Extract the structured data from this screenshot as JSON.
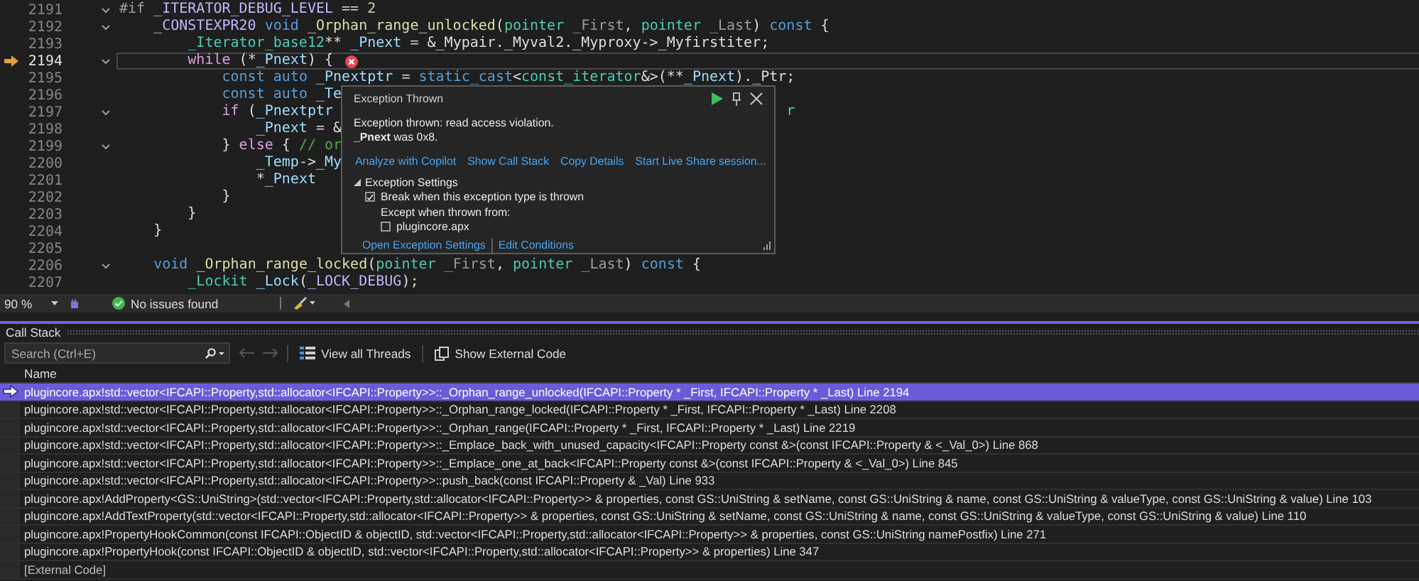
{
  "editor": {
    "lines": [
      {
        "number": "2191",
        "current": false,
        "foldable": true,
        "segments": [
          {
            "text": "#if",
            "kind": "preproc"
          },
          {
            "text": " _ITERATOR_DEBUG_LEVEL",
            "kind": "macro"
          },
          {
            "text": " ==",
            "kind": "plain"
          },
          {
            "text": " 2",
            "kind": "number"
          }
        ]
      },
      {
        "number": "2192",
        "current": false,
        "foldable": true,
        "segments": [
          {
            "text": "    _CONSTEXPR20",
            "kind": "macro"
          },
          {
            "text": " void",
            "kind": "keyword"
          },
          {
            "text": " _Orphan_range_unlocked",
            "kind": "func"
          },
          {
            "text": "(",
            "kind": "plain"
          },
          {
            "text": "pointer",
            "kind": "type"
          },
          {
            "text": " _First",
            "kind": "param"
          },
          {
            "text": ",",
            "kind": "plain"
          },
          {
            "text": " pointer",
            "kind": "type"
          },
          {
            "text": " _Last",
            "kind": "param"
          },
          {
            "text": ")",
            "kind": "plain"
          },
          {
            "text": " const",
            "kind": "keyword"
          },
          {
            "text": " {",
            "kind": "plain"
          }
        ]
      },
      {
        "number": "2193",
        "current": false,
        "foldable": false,
        "segments": [
          {
            "text": "        _Iterator_base12",
            "kind": "type"
          },
          {
            "text": "**",
            "kind": "plain"
          },
          {
            "text": " _Pnext",
            "kind": "var"
          },
          {
            "text": " = &_Mypair._Myval2._Myproxy->_Myfirstiter;",
            "kind": "plain"
          }
        ]
      },
      {
        "number": "2194",
        "current": true,
        "foldable": true,
        "error": true,
        "segments": [
          {
            "text": "        while",
            "kind": "control"
          },
          {
            "text": " (*",
            "kind": "plain"
          },
          {
            "text": "_Pnext",
            "kind": "var"
          },
          {
            "text": ") {",
            "kind": "plain"
          }
        ]
      },
      {
        "number": "2195",
        "current": false,
        "foldable": false,
        "segments": [
          {
            "text": "            const",
            "kind": "keyword"
          },
          {
            "text": " auto",
            "kind": "keyword"
          },
          {
            "text": " _Pnextptr",
            "kind": "var"
          },
          {
            "text": " =",
            "kind": "plain"
          },
          {
            "text": " static_cast",
            "kind": "keyword"
          },
          {
            "text": "<",
            "kind": "plain"
          },
          {
            "text": "const_iterator",
            "kind": "type"
          },
          {
            "text": "&>(**",
            "kind": "plain"
          },
          {
            "text": "_Pnext",
            "kind": "var"
          },
          {
            "text": ")._Ptr;",
            "kind": "plain"
          }
        ]
      },
      {
        "number": "2196",
        "current": false,
        "foldable": false,
        "segments": [
          {
            "text": "            const",
            "kind": "keyword"
          },
          {
            "text": " auto",
            "kind": "keyword"
          },
          {
            "text": " _Te",
            "kind": "var"
          }
        ]
      },
      {
        "number": "2197",
        "current": false,
        "foldable": true,
        "segments": [
          {
            "text": "            if",
            "kind": "control"
          },
          {
            "text": " (",
            "kind": "plain"
          },
          {
            "text": "_Pnextptr",
            "kind": "var"
          }
        ],
        "tail": {
          "text": "r",
          "kind": "type"
        }
      },
      {
        "number": "2198",
        "current": false,
        "foldable": false,
        "segments": [
          {
            "text": "                _Pnext",
            "kind": "var"
          },
          {
            "text": " = &",
            "kind": "plain"
          }
        ]
      },
      {
        "number": "2199",
        "current": false,
        "foldable": true,
        "segments": [
          {
            "text": "            }",
            "kind": "plain"
          },
          {
            "text": " else",
            "kind": "control"
          },
          {
            "text": " {",
            "kind": "plain"
          },
          {
            "text": " // or",
            "kind": "comment"
          }
        ]
      },
      {
        "number": "2200",
        "current": false,
        "foldable": false,
        "segments": [
          {
            "text": "                _Temp",
            "kind": "var"
          },
          {
            "text": "->",
            "kind": "plain"
          },
          {
            "text": "_My",
            "kind": "var"
          }
        ]
      },
      {
        "number": "2201",
        "current": false,
        "foldable": false,
        "segments": [
          {
            "text": "                *",
            "kind": "plain"
          },
          {
            "text": "_Pnext",
            "kind": "var"
          }
        ]
      },
      {
        "number": "2202",
        "current": false,
        "foldable": false,
        "segments": [
          {
            "text": "            }",
            "kind": "plain"
          }
        ]
      },
      {
        "number": "2203",
        "current": false,
        "foldable": false,
        "segments": [
          {
            "text": "        }",
            "kind": "plain"
          }
        ]
      },
      {
        "number": "2204",
        "current": false,
        "foldable": false,
        "segments": [
          {
            "text": "    }",
            "kind": "plain"
          }
        ]
      },
      {
        "number": "2205",
        "current": false,
        "foldable": false
      },
      {
        "number": "2206",
        "current": false,
        "foldable": true,
        "segments": [
          {
            "text": "    void",
            "kind": "keyword"
          },
          {
            "text": " _Orphan_range_locked",
            "kind": "func"
          },
          {
            "text": "(",
            "kind": "plain"
          },
          {
            "text": "pointer",
            "kind": "type"
          },
          {
            "text": " _First",
            "kind": "param"
          },
          {
            "text": ",",
            "kind": "plain"
          },
          {
            "text": " pointer",
            "kind": "type"
          },
          {
            "text": " _Last",
            "kind": "param"
          },
          {
            "text": ")",
            "kind": "plain"
          },
          {
            "text": " const",
            "kind": "keyword"
          },
          {
            "text": " {",
            "kind": "plain"
          }
        ]
      },
      {
        "number": "2207",
        "current": false,
        "foldable": false,
        "segments": [
          {
            "text": "        _Lockit",
            "kind": "type"
          },
          {
            "text": " _Lock",
            "kind": "var"
          },
          {
            "text": "(",
            "kind": "plain"
          },
          {
            "text": "_LOCK_DEBUG",
            "kind": "macro"
          },
          {
            "text": ");",
            "kind": "plain"
          }
        ]
      }
    ]
  },
  "exception_popup": {
    "title": "Exception Thrown",
    "message": "Exception thrown: read access violation.",
    "detail": "**_Pnext** was 0x8.",
    "links": [
      "Analyze with Copilot",
      "Show Call Stack",
      "Copy Details",
      "Start Live Share session..."
    ],
    "settings": {
      "title": "Exception Settings",
      "expanded": true,
      "break_option": {
        "label": "Break when this exception type is thrown",
        "checked": true
      },
      "except_label": "Except when thrown from:",
      "modules": [
        {
          "label": "plugincore.apx",
          "checked": false
        }
      ]
    },
    "footer_links": [
      "Open Exception Settings",
      "Edit Conditions"
    ]
  },
  "status_bar": {
    "zoom": "90 %",
    "issues": "No issues found"
  },
  "call_stack": {
    "title": "Call Stack",
    "search": {
      "placeholder": "Search (Ctrl+E)"
    },
    "toolbar": [
      "View all Threads",
      "Show External Code"
    ],
    "columns": [
      "Name"
    ],
    "rows": [
      {
        "name": "plugincore.apx!std::vector<IFCAPI::Property,std::allocator<IFCAPI::Property>>::_Orphan_range_unlocked(IFCAPI::Property * _First, IFCAPI::Property * _Last) Line 2194",
        "selected": true,
        "current": true,
        "external": false
      },
      {
        "name": "plugincore.apx!std::vector<IFCAPI::Property,std::allocator<IFCAPI::Property>>::_Orphan_range_locked(IFCAPI::Property * _First, IFCAPI::Property * _Last) Line 2208",
        "selected": false,
        "current": false,
        "external": false
      },
      {
        "name": "plugincore.apx!std::vector<IFCAPI::Property,std::allocator<IFCAPI::Property>>::_Orphan_range(IFCAPI::Property * _First, IFCAPI::Property * _Last) Line 2219",
        "selected": false,
        "current": false,
        "external": false
      },
      {
        "name": "plugincore.apx!std::vector<IFCAPI::Property,std::allocator<IFCAPI::Property>>::_Emplace_back_with_unused_capacity<IFCAPI::Property const &>(const IFCAPI::Property & <_Val_0>) Line 868",
        "selected": false,
        "current": false,
        "external": false
      },
      {
        "name": "plugincore.apx!std::vector<IFCAPI::Property,std::allocator<IFCAPI::Property>>::_Emplace_one_at_back<IFCAPI::Property const &>(const IFCAPI::Property & <_Val_0>) Line 845",
        "selected": false,
        "current": false,
        "external": false
      },
      {
        "name": "plugincore.apx!std::vector<IFCAPI::Property,std::allocator<IFCAPI::Property>>::push_back(const IFCAPI::Property & _Val) Line 933",
        "selected": false,
        "current": false,
        "external": false
      },
      {
        "name": "plugincore.apx!AddProperty<GS::UniString>(std::vector<IFCAPI::Property,std::allocator<IFCAPI::Property>> & properties, const GS::UniString & setName, const GS::UniString & name, const GS::UniString & valueType, const GS::UniString & value) Line 103",
        "selected": false,
        "current": false,
        "external": false
      },
      {
        "name": "plugincore.apx!AddTextProperty(std::vector<IFCAPI::Property,std::allocator<IFCAPI::Property>> & properties, const GS::UniString & setName, const GS::UniString & name, const GS::UniString & valueType, const GS::UniString & value) Line 110",
        "selected": false,
        "current": false,
        "external": false
      },
      {
        "name": "plugincore.apx!PropertyHookCommon(const IFCAPI::ObjectID & objectID, std::vector<IFCAPI::Property,std::allocator<IFCAPI::Property>> & properties, const GS::UniString namePostfix) Line 271",
        "selected": false,
        "current": false,
        "external": false
      },
      {
        "name": "plugincore.apx!PropertyHook(const IFCAPI::ObjectID & objectID, std::vector<IFCAPI::Property,std::allocator<IFCAPI::Property>> & properties) Line 347",
        "selected": false,
        "current": false,
        "external": false
      },
      {
        "name": "[External Code]",
        "selected": false,
        "current": false,
        "external": true
      }
    ]
  }
}
